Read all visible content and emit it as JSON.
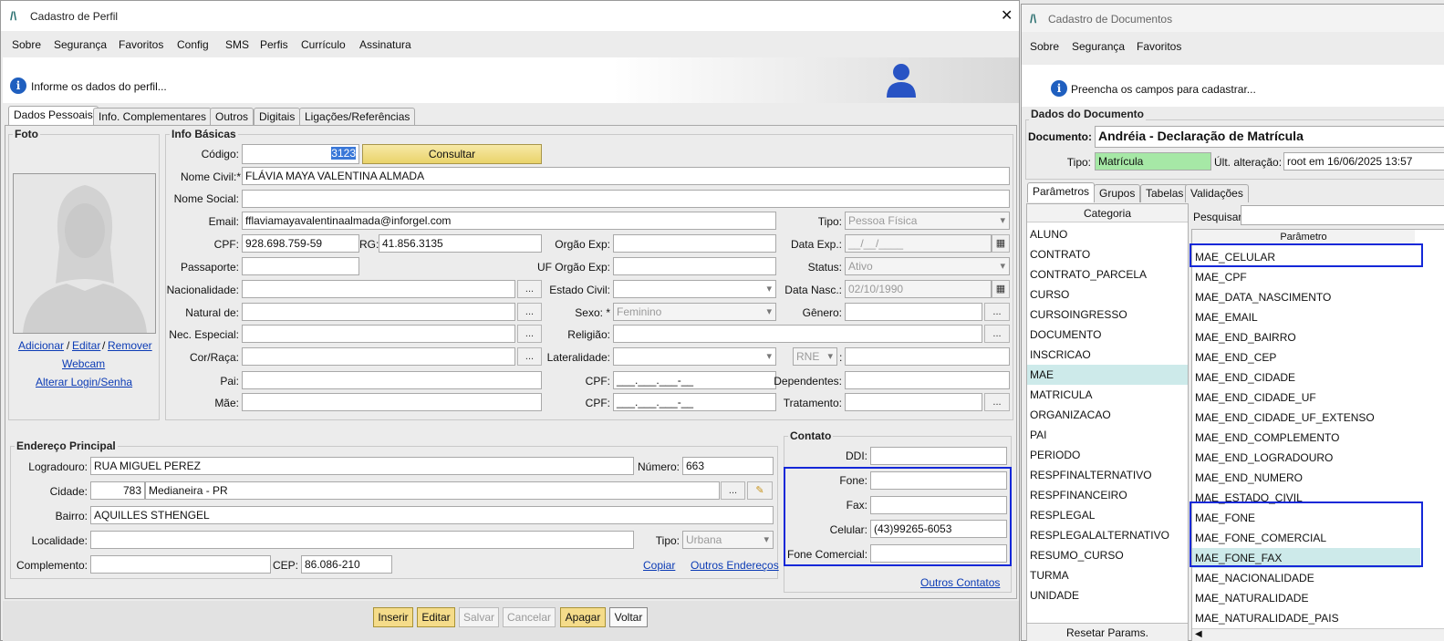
{
  "left": {
    "title": "Cadastro de Perfil",
    "menu": [
      "Sobre",
      "Segurança",
      "Favoritos",
      "Config",
      "SMS",
      "Perfis",
      "Currículo",
      "Assinatura"
    ],
    "info": "Informe os dados do perfil...",
    "tabs": [
      "Dados Pessoais",
      "Info. Complementares",
      "Outros",
      "Digitais",
      "Ligações/Referências"
    ],
    "foto": {
      "title": "Foto",
      "add": "Adicionar",
      "edit": "Editar",
      "remove": "Remover",
      "sep": "/",
      "webcam": "Webcam",
      "login": "Alterar Login/Senha"
    },
    "info_basicas": {
      "title": "Info Básicas",
      "codigo_label": "Código:",
      "codigo": "3123",
      "consultar": "Consultar",
      "nome_civil_label": "Nome Civil:*",
      "nome_civil": "FLÁVIA MAYA VALENTINA ALMADA",
      "nome_social_label": "Nome Social:",
      "email_label": "Email:",
      "email": "fflaviamayavalentinaalmada@inforgel.com",
      "tipo_label": "Tipo:",
      "tipo": "Pessoa Física",
      "cpf_label": "CPF:",
      "cpf": "928.698.759-59",
      "rg_label": "RG:",
      "rg": "41.856.3135",
      "orgao_label": "Orgão Exp:",
      "data_exp_label": "Data Exp.:",
      "data_exp": "__/__/____",
      "passaporte_label": "Passaporte:",
      "uf_label": "UF Orgão Exp:",
      "status_label": "Status:",
      "status": "Ativo",
      "nacionalidade_label": "Nacionalidade:",
      "estado_civil_label": "Estado Civil:",
      "data_nasc_label": "Data Nasc.:",
      "data_nasc": "02/10/1990",
      "natural_label": "Natural de:",
      "sexo_label": "Sexo: *",
      "sexo": "Feminino",
      "genero_label": "Gênero:",
      "nec_label": "Nec. Especial:",
      "religiao_label": "Religião:",
      "cor_label": "Cor/Raça:",
      "lateralidade_label": "Lateralidade:",
      "rne": "RNE",
      "colon": ":",
      "pai_label": "Pai:",
      "cpf_pai_label": "CPF:",
      "cpf_pai": "___.___.___-__",
      "dependentes_label": "Dependentes:",
      "mae_label": "Mãe:",
      "cpf_mae_label": "CPF:",
      "cpf_mae": "___.___.___-__",
      "tratamento_label": "Tratamento:",
      "ellipsis": "..."
    },
    "endereco": {
      "title": "Endereço Principal",
      "logradouro_label": "Logradouro:",
      "logradouro": "RUA MIGUEL PEREZ",
      "numero_label": "Número:",
      "numero": "663",
      "cidade_label": "Cidade:",
      "cidade_cod": "783",
      "cidade": "Medianeira - PR",
      "bairro_label": "Bairro:",
      "bairro": "AQUILLES STHENGEL",
      "localidade_label": "Localidade:",
      "tipo_label": "Tipo:",
      "tipo": "Urbana",
      "complemento_label": "Complemento:",
      "cep_label": "CEP:",
      "cep": "86.086-210",
      "copiar": "Copiar",
      "outros": "Outros Endereços"
    },
    "contato": {
      "title": "Contato",
      "ddi_label": "DDI:",
      "fone_label": "Fone:",
      "fax_label": "Fax:",
      "celular_label": "Celular:",
      "celular": "(43)99265-6053",
      "fone_com_label": "Fone Comercial:",
      "outros": "Outros Contatos"
    },
    "buttons": [
      "Inserir",
      "Editar",
      "Salvar",
      "Cancelar",
      "Apagar",
      "Voltar"
    ]
  },
  "right": {
    "title": "Cadastro de Documentos",
    "menu": [
      "Sobre",
      "Segurança",
      "Favoritos"
    ],
    "info": "Preencha os campos para cadastrar...",
    "dados_title": "Dados do Documento",
    "documento_label": "Documento:",
    "documento": "Andréia - Declaração de Matrícula",
    "tipo_label": "Tipo:",
    "tipo": "Matrícula",
    "ult_label": "Últ. alteração:",
    "ult": "root em 16/06/2025 13:57",
    "tabs": [
      "Parâmetros",
      "Grupos",
      "Tabelas",
      "Validações"
    ],
    "categoria_header": "Categoria",
    "categorias": [
      "ALUNO",
      "CONTRATO",
      "CONTRATO_PARCELA",
      "CURSO",
      "CURSOINGRESSO",
      "DOCUMENTO",
      "INSCRICAO",
      "MAE",
      "MATRICULA",
      "ORGANIZACAO",
      "PAI",
      "PERIODO",
      "RESPFINALTERNATIVO",
      "RESPFINANCEIRO",
      "RESPLEGAL",
      "RESPLEGALALTERNATIVO",
      "RESUMO_CURSO",
      "TURMA",
      "UNIDADE"
    ],
    "pesquisar_label": "Pesquisar:",
    "parametro_header": "Parâmetro",
    "parametros": [
      "MAE_CELULAR",
      "MAE_CPF",
      "MAE_DATA_NASCIMENTO",
      "MAE_EMAIL",
      "MAE_END_BAIRRO",
      "MAE_END_CEP",
      "MAE_END_CIDADE",
      "MAE_END_CIDADE_UF",
      "MAE_END_CIDADE_UF_EXTENSO",
      "MAE_END_COMPLEMENTO",
      "MAE_END_LOGRADOURO",
      "MAE_END_NUMERO",
      "MAE_ESTADO_CIVIL",
      "MAE_FONE",
      "MAE_FONE_COMERCIAL",
      "MAE_FONE_FAX",
      "MAE_NACIONALIDADE",
      "MAE_NATURALIDADE",
      "MAE_NATURALIDADE_PAIS"
    ],
    "reset": "Resetar Params."
  },
  "colors": {
    "highlight": "#1428d8",
    "selected_row": "#cdeaea",
    "tipo_green": "#a6e8a6",
    "button_yellow": "#f5dc8a"
  }
}
